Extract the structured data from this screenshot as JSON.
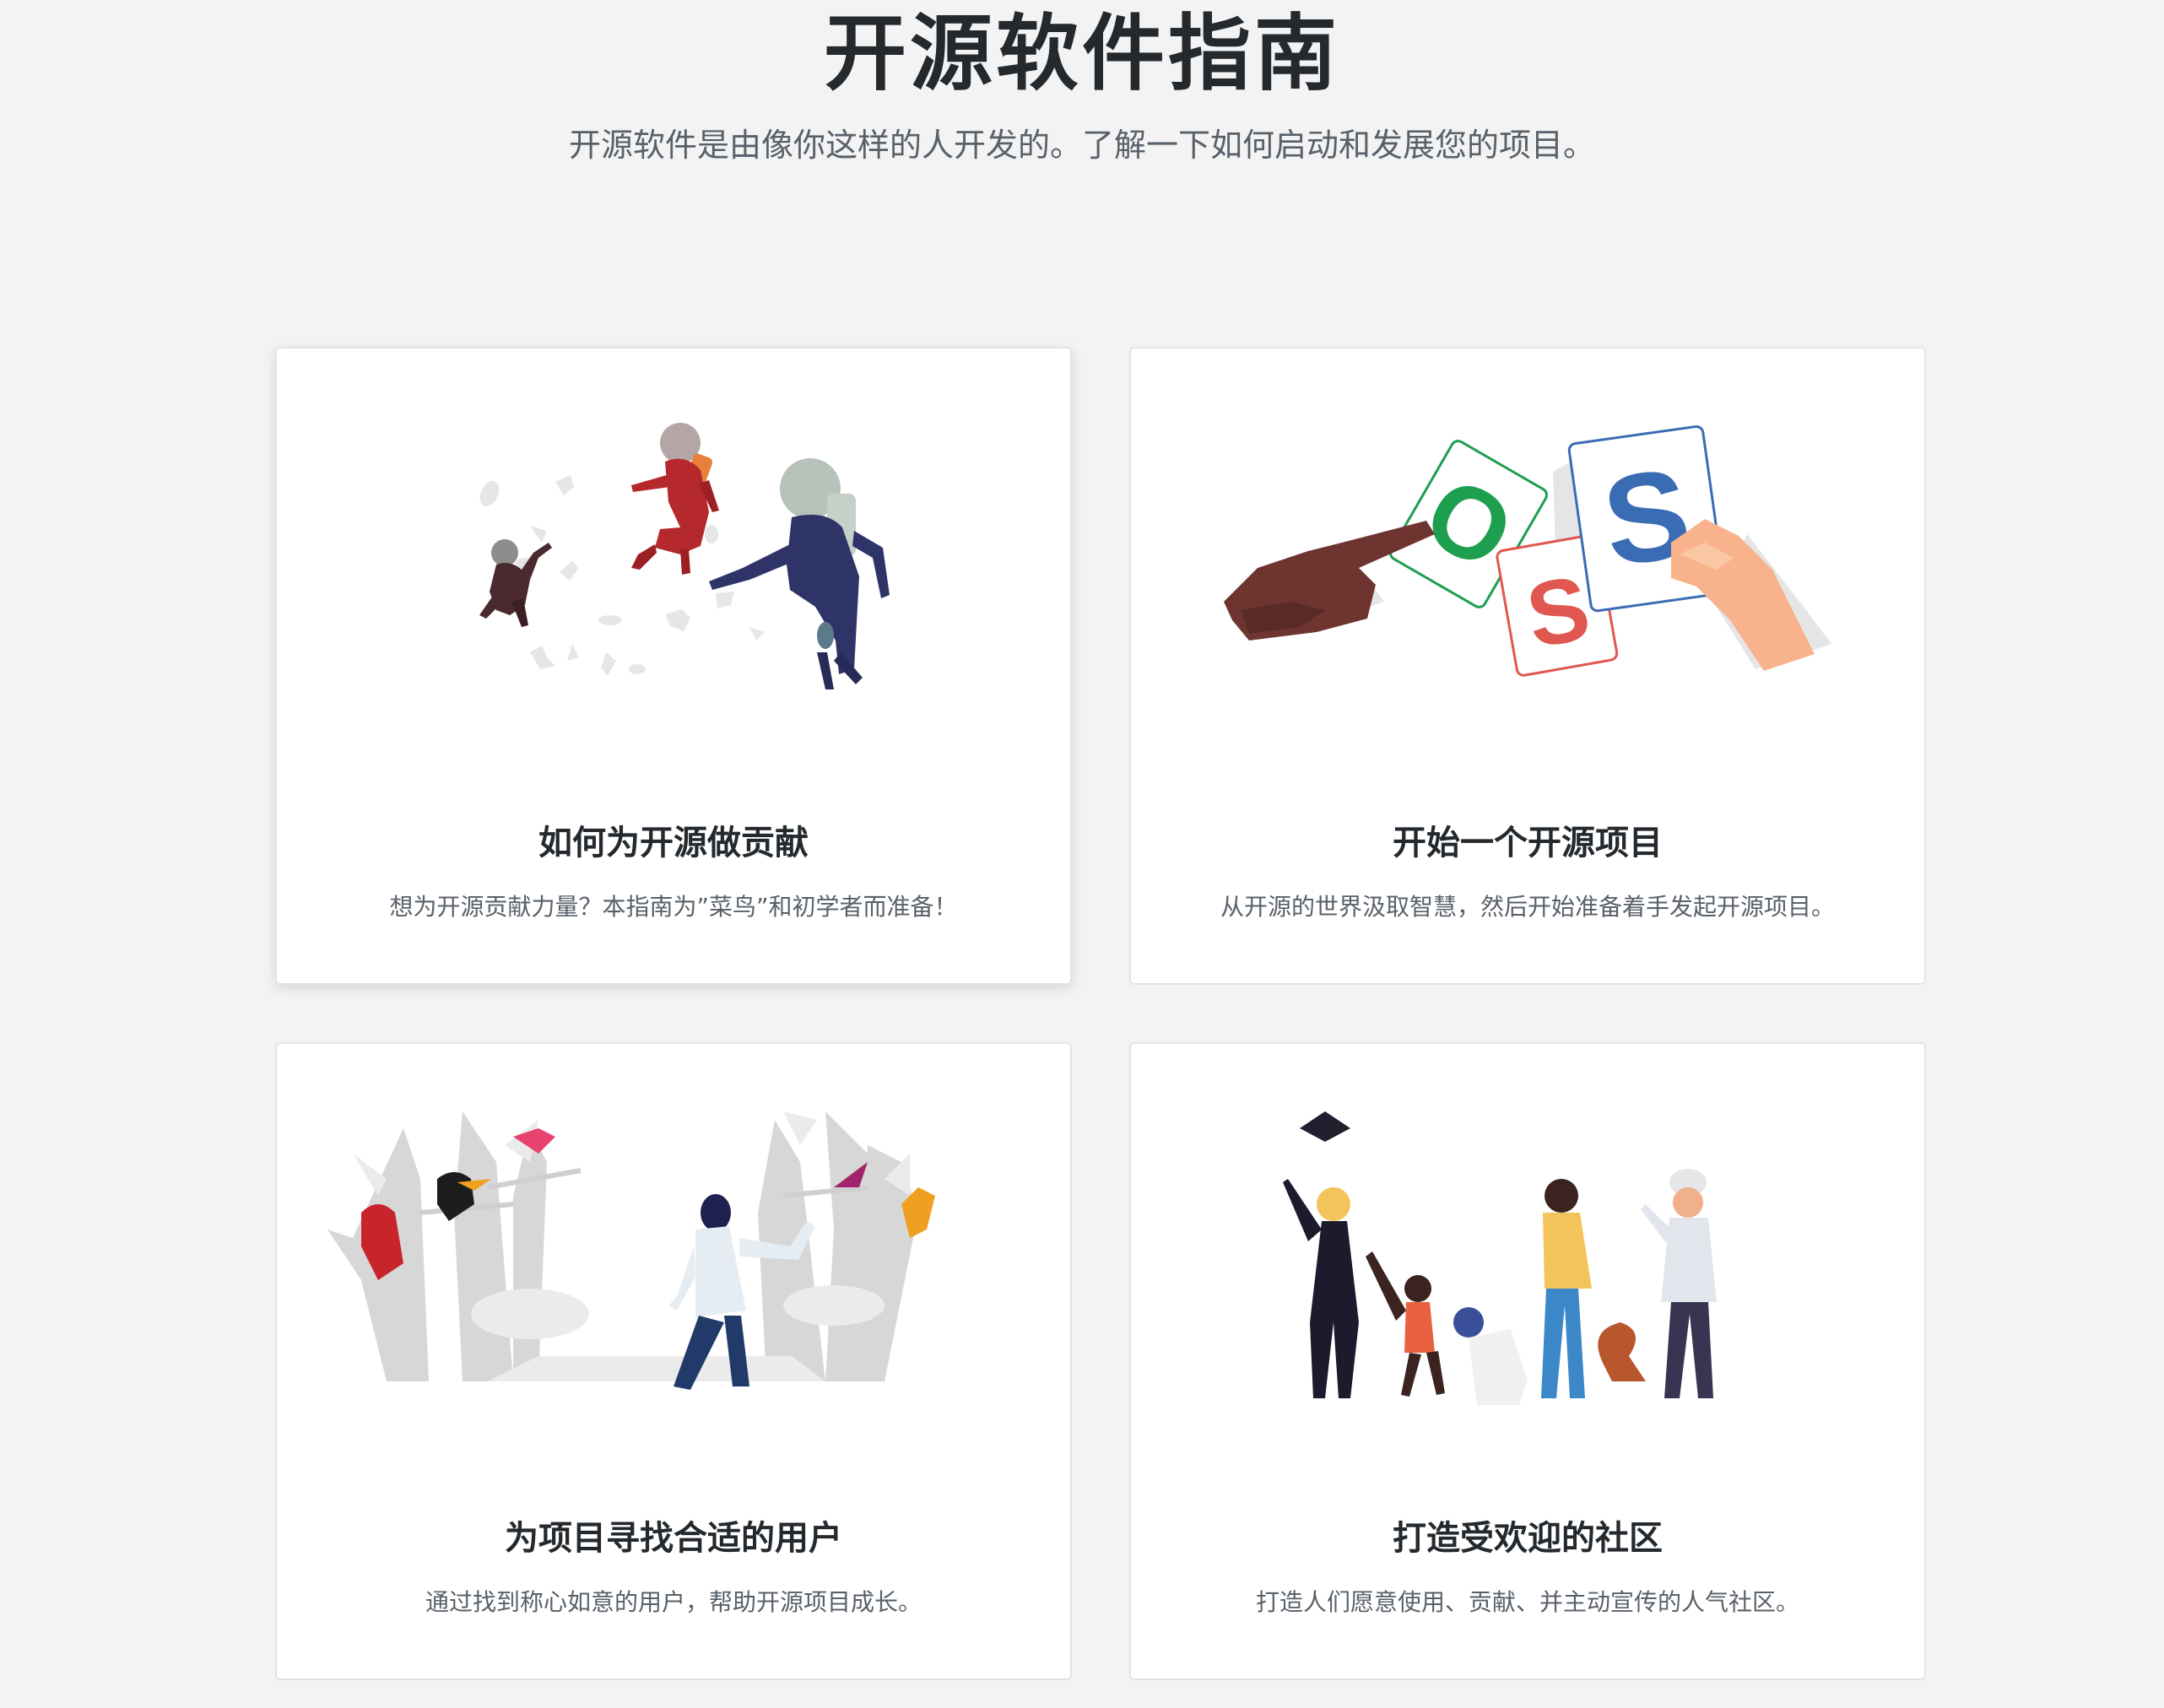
{
  "hero": {
    "title": "开源软件指南",
    "subtitle": "开源软件是由像你这样的人开发的。了解一下如何启动和发展您的项目。"
  },
  "guides": [
    {
      "title": "如何为开源做贡献",
      "description": "想为开源贡献力量？本指南为”菜鸟”和初学者而准备！",
      "illustration": "astronauts-floating-illustration"
    },
    {
      "title": "开始一个开源项目",
      "description": "从开源的世界汲取智慧，然后开始准备着手发起开源项目。",
      "illustration": "oss-letter-cards-illustration",
      "card_letters": [
        "O",
        "S",
        "S"
      ]
    },
    {
      "title": "为项目寻找合适的用户",
      "description": "通过找到称心如意的用户，帮助开源项目成长。",
      "illustration": "forest-birds-illustration"
    },
    {
      "title": "打造受欢迎的社区",
      "description": "打造人们愿意使用、贡献、并主动宣传的人气社区。",
      "illustration": "community-people-illustration"
    }
  ],
  "colors": {
    "page_background": "#f3f3f3",
    "card_background": "#ffffff",
    "card_border": "#e1e4e8",
    "title_text": "#24292e",
    "body_text": "#586069",
    "card_letter_green": "#1e9e4f",
    "card_letter_red": "#e0574f",
    "card_letter_blue": "#3a6cb4"
  }
}
